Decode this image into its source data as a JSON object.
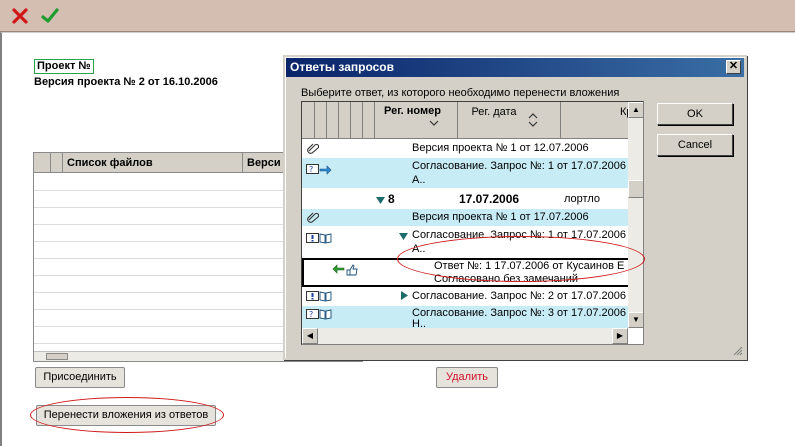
{
  "toolbar": {
    "cancel_icon": "close-icon",
    "confirm_icon": "checkmark-icon"
  },
  "project": {
    "title": "Проект №",
    "version": "Версия проекта № 2 от 16.10.2006"
  },
  "files": {
    "columns": [
      "Список файлов",
      "Верси"
    ]
  },
  "buttons": {
    "attach": "Присоединить",
    "delete": "Удалить",
    "transfer": "Перенести вложения из ответов"
  },
  "dialog": {
    "title": "Ответы запросов",
    "close_glyph": "✕",
    "prompt": "Выберите ответ, из которого необходимо перенести вложения",
    "columns": {
      "reg_number": "Рег. номер",
      "reg_date": "Рег. дата",
      "brief": "Кра"
    },
    "rows": [
      {
        "text": "Версия проекта № 1 от 12.07.2006",
        "icon": "paperclip-icon"
      },
      {
        "text": "Согласование. Запрос №: 1 от 17.07.2006",
        "text2": "А..",
        "icon": "request-icon"
      },
      {
        "number": "8",
        "date": "17.07.2006",
        "extra": "лортло"
      },
      {
        "text": "Версия проекта № 1 от 17.07.2006",
        "icon": "paperclip-icon"
      },
      {
        "text": "Согласование. Запрос №: 1 от 17.07.2006",
        "text2": "А..",
        "icon": "book-icon"
      },
      {
        "text": "Ответ №: 1 17.07.2006 от Кусаинов Е",
        "text2": "Согласовано без замечаний",
        "icon": "reply-icon"
      },
      {
        "text": "Согласование. Запрос №: 2 от 17.07.2006",
        "icon": "book-icon"
      },
      {
        "text": "Согласование. Запрос №: 3 от 17.07.2006",
        "text2": "Н..",
        "icon": "request-icon"
      }
    ],
    "ok": "OK",
    "cancel": "Cancel"
  },
  "colors": {
    "toolbar_bg": "#d4bdb1",
    "highlight_row": "#c7ecf6",
    "annotation": "#d11a1a",
    "titlebar": "#0a246a"
  }
}
